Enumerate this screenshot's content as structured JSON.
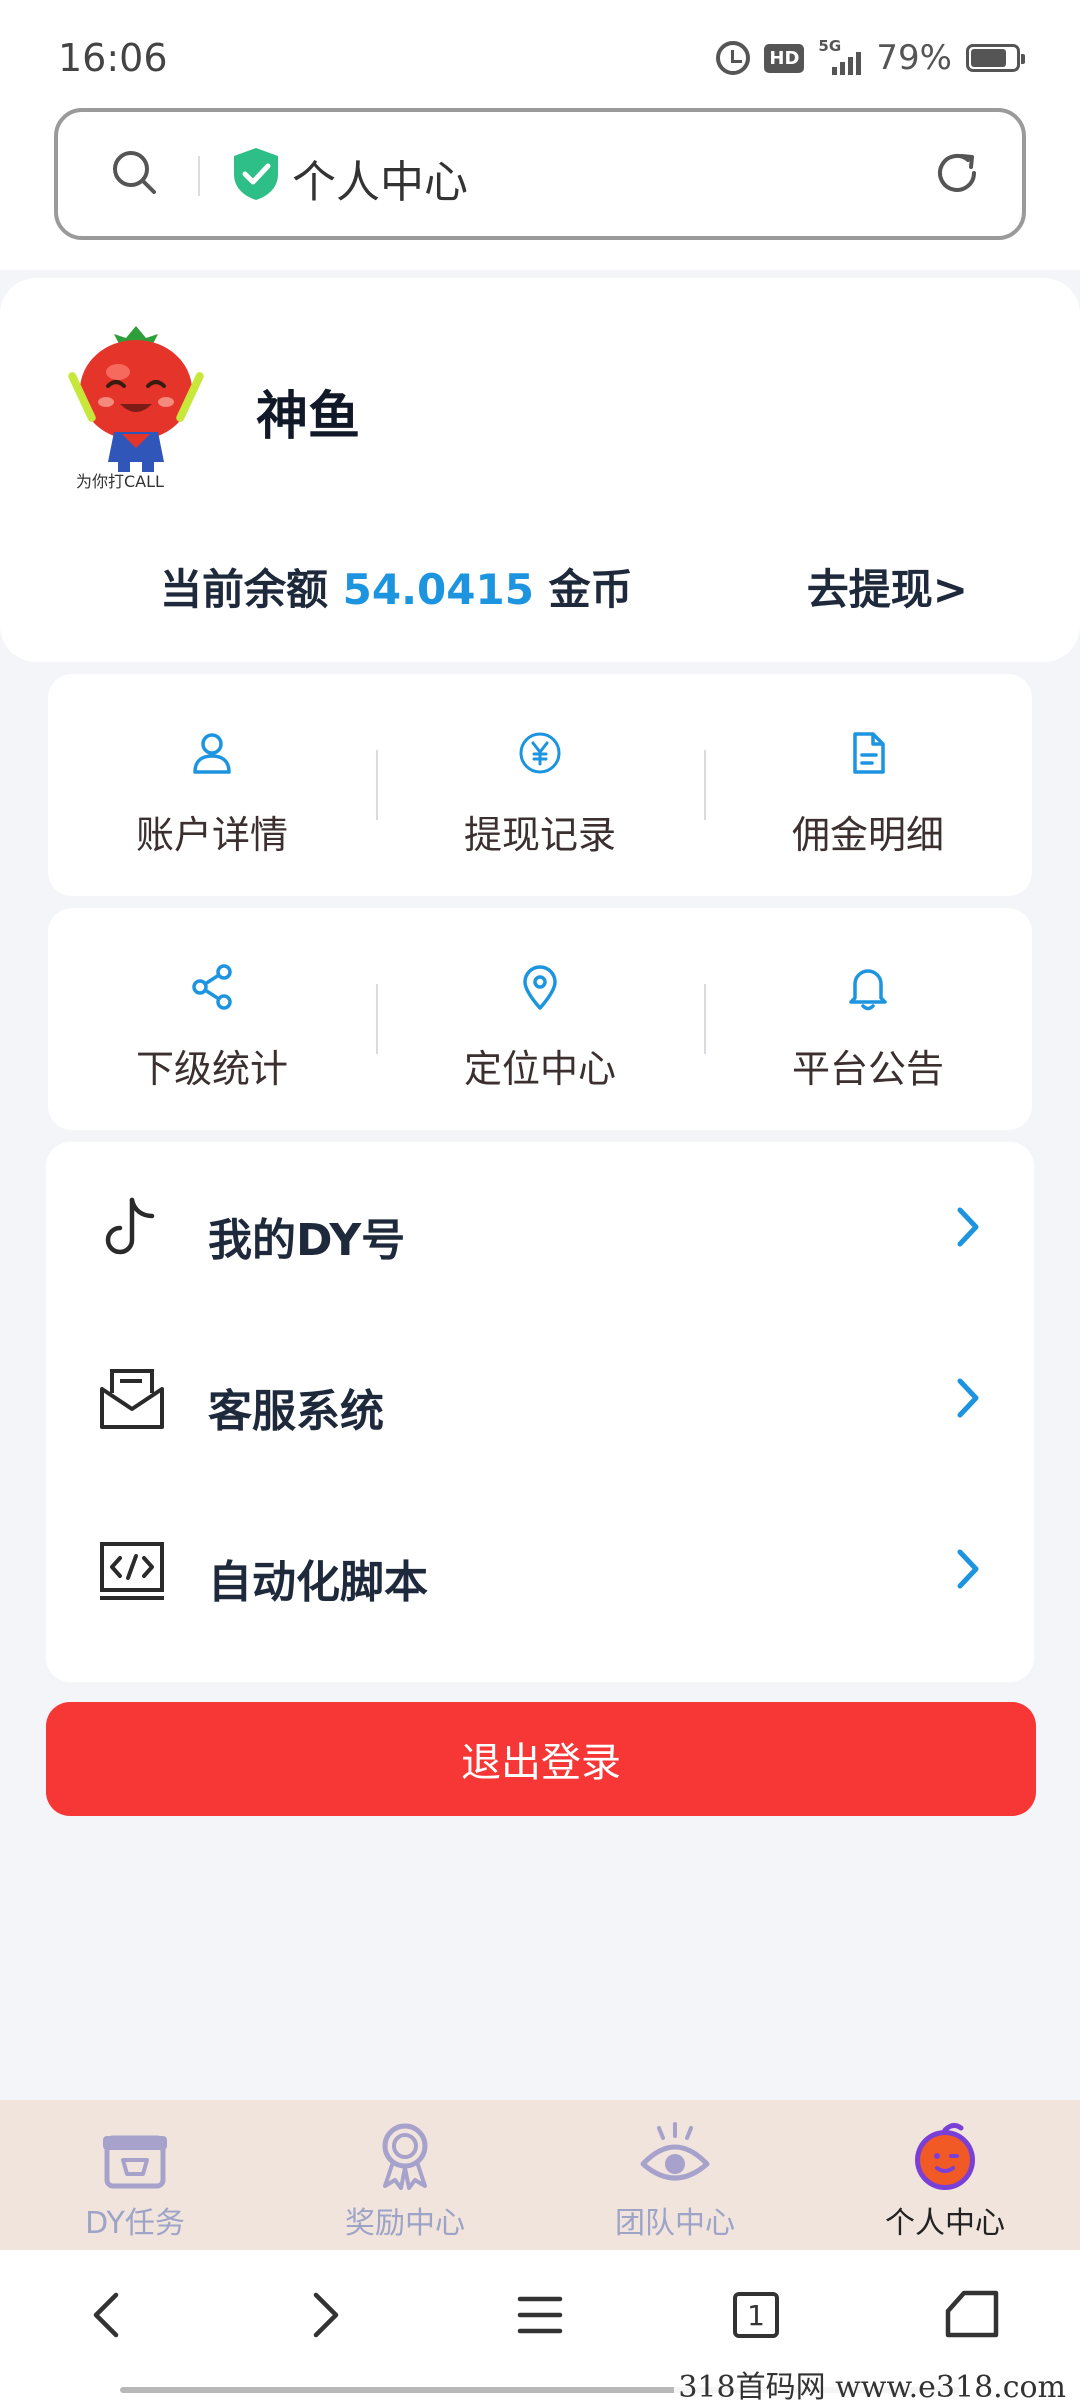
{
  "status_bar": {
    "time": "16:06",
    "hd": "HD",
    "network": "5G",
    "battery": "79%",
    "battery_level": 0.79
  },
  "address_bar": {
    "title": "个人中心"
  },
  "profile": {
    "username": "神鱼",
    "avatar_caption": "为你打CALL",
    "balance_label": "当前余额",
    "balance_value": "54.0415",
    "balance_unit": "金币",
    "withdraw_link": "去提现>"
  },
  "grid1": [
    {
      "label": "账户详情",
      "icon": "user-icon"
    },
    {
      "label": "提现记录",
      "icon": "yen-circle-icon"
    },
    {
      "label": "佣金明细",
      "icon": "document-icon"
    }
  ],
  "grid2": [
    {
      "label": "下级统计",
      "icon": "share-icon"
    },
    {
      "label": "定位中心",
      "icon": "location-pin-icon"
    },
    {
      "label": "平台公告",
      "icon": "bell-icon"
    }
  ],
  "menu": [
    {
      "label": "我的DY号",
      "icon": "tiktok-icon"
    },
    {
      "label": "客服系统",
      "icon": "mail-tray-icon"
    },
    {
      "label": "自动化脚本",
      "icon": "code-icon"
    }
  ],
  "logout_label": "退出登录",
  "tabs": [
    {
      "label": "DY任务",
      "icon": "gift-box-icon",
      "active": false
    },
    {
      "label": "奖励中心",
      "icon": "medal-icon",
      "active": false
    },
    {
      "label": "团队中心",
      "icon": "eye-icon",
      "active": false
    },
    {
      "label": "个人中心",
      "icon": "orange-face-icon",
      "active": true
    }
  ],
  "browser_nav": {
    "tab_count": "1"
  },
  "watermark": "318首码网 www.e318.com",
  "colors": {
    "accent_blue": "#1d94e0",
    "logout_red": "#f73636",
    "tabbar_bg": "#f0e4dc",
    "tab_inactive": "#9ea3c8"
  }
}
